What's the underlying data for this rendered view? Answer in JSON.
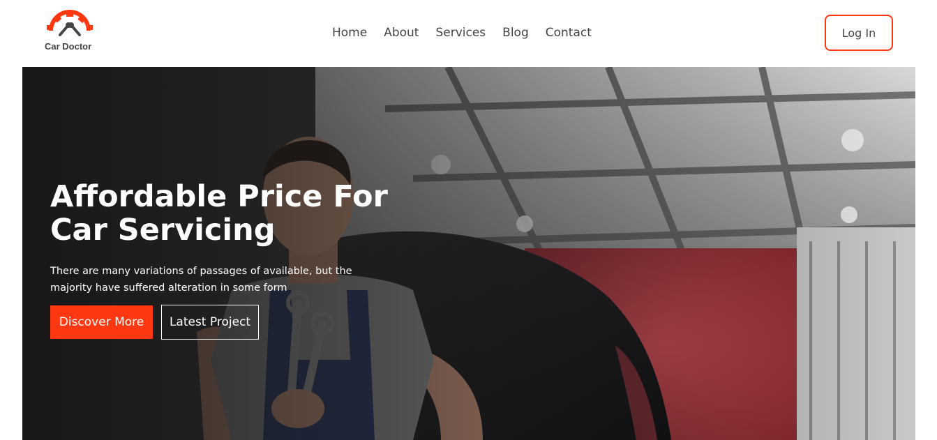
{
  "brand": {
    "name": "Car Doctor",
    "icon": "gear-wrench-logo-icon",
    "accent_color": "#FF3811"
  },
  "nav": {
    "items": [
      {
        "label": "Home"
      },
      {
        "label": "About"
      },
      {
        "label": "Services"
      },
      {
        "label": "Blog"
      },
      {
        "label": "Contact"
      }
    ]
  },
  "header": {
    "login_label": "Log In"
  },
  "hero": {
    "title": "Affordable Price For Car Servicing",
    "description": "There are many variations of passages of available, but the majority have suffered alteration in some form",
    "primary_button": "Discover More",
    "secondary_button": "Latest Project",
    "image": "mechanic-with-wrenches-in-garage"
  }
}
